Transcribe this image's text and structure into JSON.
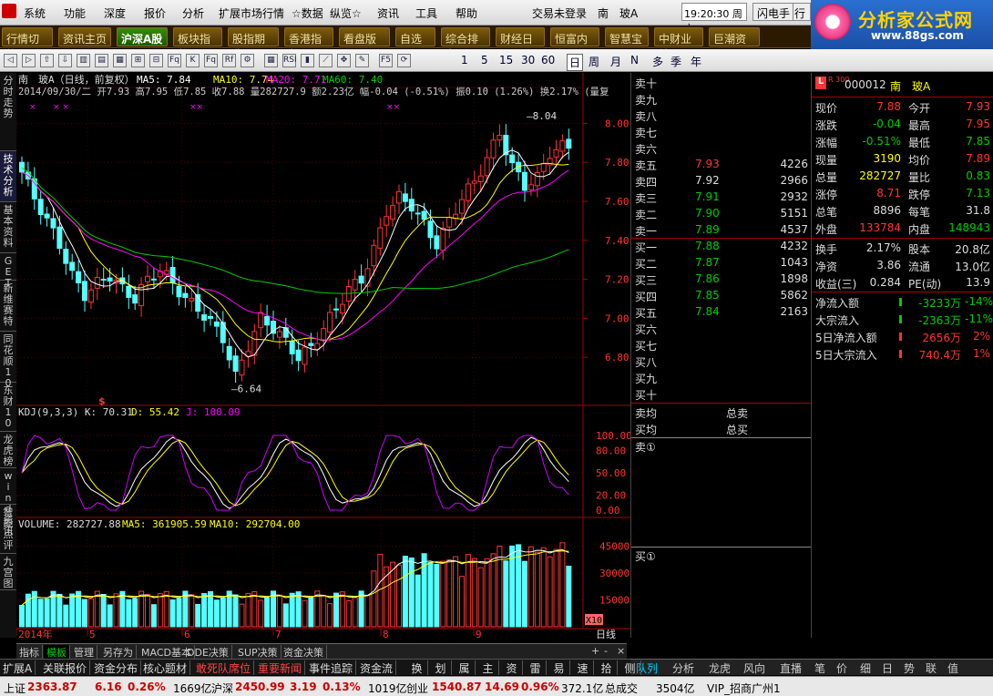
{
  "menu": {
    "items": [
      "系统",
      "功能",
      "深度",
      "报价",
      "分析",
      "扩展市场行情",
      "☆数据",
      "纵览☆",
      "资讯",
      "工具",
      "帮助"
    ],
    "login": "交易未登录",
    "stock_short": "南　玻A",
    "clock": "19:20:30 周六",
    "flash_btn": "闪电手",
    "hq_btn": "行"
  },
  "brand": {
    "name": "分析家公式网",
    "url": "www.88gs.com"
  },
  "tabs": [
    "行情切换",
    "资讯主页",
    "沪深A股",
    "板块指数",
    "股指期货",
    "香港指数",
    "看盘版面",
    "自选股",
    "综合排名",
    "财经日历",
    "恒富内参",
    "智慧宝",
    "中财业绩",
    "巨潮资讯"
  ],
  "active_tab": 2,
  "toolbar": {
    "periods": [
      "1",
      "5",
      "15",
      "30",
      "60",
      "日",
      "周",
      "月",
      "N",
      "多",
      "季",
      "年"
    ],
    "icons": [
      "back-icon",
      "forward-icon",
      "up-icon",
      "down-icon",
      "candle-icon",
      "bar-icon",
      "line-icon",
      "zoom-in-icon",
      "zoom-out-icon",
      "fq-icon",
      "k-icon",
      "fq2-icon",
      "rf-icon",
      "settings-icon",
      "indicator-icon",
      "rsi-icon",
      "stat-icon",
      "drawline-icon",
      "move-icon",
      "pen-icon",
      "f5-icon",
      "refresh-icon"
    ]
  },
  "left_tabs": [
    "分时走势",
    "技术分析",
    "基本资料",
    "GET",
    "新维赛特",
    "同花顺10",
    "东财10",
    "龙虎榜",
    "wind资讯",
    "智能点评",
    "九宫图"
  ],
  "chart": {
    "header_line1": "南　玻A（日线，前复权）",
    "ma_labels": [
      "MA5: 7.84",
      "MA10: 7.74",
      "MA20: 7.71",
      "MA60: 7.40"
    ],
    "header_line2": "2014/09/30/二 开7.93 高7.95 低7.85 收7.88 量282727.9 额2.23亿 幅-0.04 (-0.51%) 振0.10 (1.26%) 换2.17% (量复",
    "price_axis": [
      "8.00",
      "7.80",
      "7.60",
      "7.40",
      "7.20",
      "7.00",
      "6.80"
    ],
    "high_mark": "8.04",
    "low_mark": "6.64",
    "kdj_title": "KDJ(9,3,3) K: 70.31",
    "kdj_d": "D: 55.42",
    "kdj_j": "J: 100.09",
    "kdj_axis": [
      "100.00",
      "80.00",
      "50.00",
      "20.00",
      "0.00"
    ],
    "vol_title": "VOLUME: 282727.88",
    "vol_ma5": "MA5: 361905.59",
    "vol_ma10": "MA10: 292704.00",
    "vol_axis": [
      "45000",
      "30000",
      "15000"
    ],
    "vol_unit": "X10",
    "date_axis": [
      "2014年",
      "5",
      "6",
      "7",
      "8",
      "9"
    ],
    "period_label": "日线"
  },
  "chart_data": {
    "type": "candlestick",
    "title": "南玻A 日线 前复权",
    "ylim": [
      6.6,
      8.1
    ],
    "ohlc_close_trend": [
      7.75,
      7.62,
      7.5,
      7.38,
      7.22,
      7.12,
      7.18,
      7.22,
      7.15,
      7.1,
      7.2,
      7.25,
      7.18,
      7.1,
      7.05,
      6.98,
      6.9,
      6.7,
      6.86,
      7.0,
      6.95,
      6.88,
      6.8,
      6.85,
      6.95,
      7.05,
      7.15,
      7.2,
      7.35,
      7.55,
      7.62,
      7.58,
      7.48,
      7.38,
      7.5,
      7.62,
      7.7,
      7.82,
      7.95,
      7.78,
      7.68,
      7.72,
      7.85,
      7.88
    ],
    "high": 8.04,
    "low": 6.64
  },
  "bottom_tabs": [
    "指标",
    "模板",
    "管理",
    "另存为",
    "MACD基本",
    "DDE决策",
    "SUP决策",
    "资金决策"
  ],
  "bottom_tabs_active": 1,
  "orderbook": {
    "sells": [
      {
        "label": "卖十",
        "price": "",
        "vol": ""
      },
      {
        "label": "卖九",
        "price": "",
        "vol": ""
      },
      {
        "label": "卖八",
        "price": "",
        "vol": ""
      },
      {
        "label": "卖七",
        "price": "",
        "vol": ""
      },
      {
        "label": "卖六",
        "price": "",
        "vol": ""
      },
      {
        "label": "卖五",
        "price": "7.93",
        "vol": "4226"
      },
      {
        "label": "卖四",
        "price": "7.92",
        "vol": "2966"
      },
      {
        "label": "卖三",
        "price": "7.91",
        "vol": "2932"
      },
      {
        "label": "卖二",
        "price": "7.90",
        "vol": "5151"
      },
      {
        "label": "卖一",
        "price": "7.89",
        "vol": "4537"
      }
    ],
    "buys": [
      {
        "label": "买一",
        "price": "7.88",
        "vol": "4232"
      },
      {
        "label": "买二",
        "price": "7.87",
        "vol": "1043"
      },
      {
        "label": "买三",
        "price": "7.86",
        "vol": "1898"
      },
      {
        "label": "买四",
        "price": "7.85",
        "vol": "5862"
      },
      {
        "label": "买五",
        "price": "7.84",
        "vol": "2163"
      },
      {
        "label": "买六",
        "price": "",
        "vol": ""
      },
      {
        "label": "买七",
        "price": "",
        "vol": ""
      },
      {
        "label": "买八",
        "price": "",
        "vol": ""
      },
      {
        "label": "买九",
        "price": "",
        "vol": ""
      },
      {
        "label": "买十",
        "price": "",
        "vol": ""
      }
    ],
    "sell_avg": "卖均",
    "sell_total": "总卖",
    "buy_avg": "买均",
    "buy_total": "总买",
    "sell_queue": "卖①",
    "buy_queue": "买①"
  },
  "quote": {
    "code": "000012",
    "name": "南　玻A",
    "index_badge": "R 300",
    "rows": [
      {
        "l1": "现价",
        "v1": "7.88",
        "l2": "今开",
        "v2": "7.93",
        "c1": "#f33",
        "c2": "#f33"
      },
      {
        "l1": "涨跌",
        "v1": "-0.04",
        "l2": "最高",
        "v2": "7.95",
        "c1": "#0c0",
        "c2": "#f33"
      },
      {
        "l1": "涨幅",
        "v1": "-0.51%",
        "l2": "最低",
        "v2": "7.85",
        "c1": "#0c0",
        "c2": "#0c0"
      },
      {
        "l1": "现量",
        "v1": "3190",
        "l2": "均价",
        "v2": "7.89",
        "c1": "#ff0",
        "c2": "#f33"
      },
      {
        "l1": "总量",
        "v1": "282727",
        "l2": "量比",
        "v2": "0.83",
        "c1": "#ff0",
        "c2": "#0c0"
      },
      {
        "l1": "涨停",
        "v1": "8.71",
        "l2": "跌停",
        "v2": "7.13",
        "c1": "#f33",
        "c2": "#0c0"
      },
      {
        "l1": "总笔",
        "v1": "8896",
        "l2": "每笔",
        "v2": "31.8",
        "c1": "#ddd",
        "c2": "#ddd"
      },
      {
        "l1": "外盘",
        "v1": "133784",
        "l2": "内盘",
        "v2": "148943",
        "c1": "#f33",
        "c2": "#0c0"
      }
    ],
    "rows2": [
      {
        "l1": "换手",
        "v1": "2.17%",
        "l2": "股本",
        "v2": "20.8亿"
      },
      {
        "l1": "净资",
        "v1": "3.86",
        "l2": "流通",
        "v2": "13.0亿"
      },
      {
        "l1": "收益(三)",
        "v1": "0.284",
        "l2": "PE(动)",
        "v2": "13.9"
      }
    ],
    "flows": [
      {
        "label": "净流入额",
        "amount": "-3233万",
        "pct": "-14%",
        "color": "#0c0"
      },
      {
        "label": "大宗流入",
        "amount": "-2363万",
        "pct": "-11%",
        "color": "#0c0"
      },
      {
        "label": "5日净流入额",
        "amount": "2656万",
        "pct": "2%",
        "color": "#f33"
      },
      {
        "label": "5日大宗流入",
        "amount": "740.4万",
        "pct": "1%",
        "color": "#f33"
      }
    ]
  },
  "right_tabs": [
    "队列",
    "分析",
    "龙虎",
    "风向",
    "直播",
    "笔",
    "价",
    "细",
    "日",
    "势",
    "联",
    "值"
  ],
  "right_tabs_active": 0,
  "left_strip_icons": [
    "换",
    "划",
    "属",
    "主",
    "资",
    "雷",
    "易",
    "速",
    "拾",
    "侧"
  ],
  "status1": [
    "扩展A",
    "关联报价",
    "资金分布",
    "核心题材",
    "敢死队席位",
    "重要新闻",
    "事件追踪",
    "资金流"
  ],
  "status2": {
    "sh_label": "上证",
    "sh_val": "2363.87",
    "sh_chg": "6.16",
    "sh_pct": "0.26%",
    "sh_amt": "1669亿",
    "hs_label": "沪深",
    "hs_val": "2450.99",
    "hs_chg": "3.19",
    "hs_pct": "0.13%",
    "hs_amt": "1019亿",
    "cy_label": "创业",
    "cy_val": "1540.87",
    "cy_chg": "14.69",
    "cy_pct": "0.96%",
    "cy_amt": "372.1亿",
    "total_label": "总成交",
    "total_val": "3504亿",
    "vip": "VIP_招商广州1"
  }
}
